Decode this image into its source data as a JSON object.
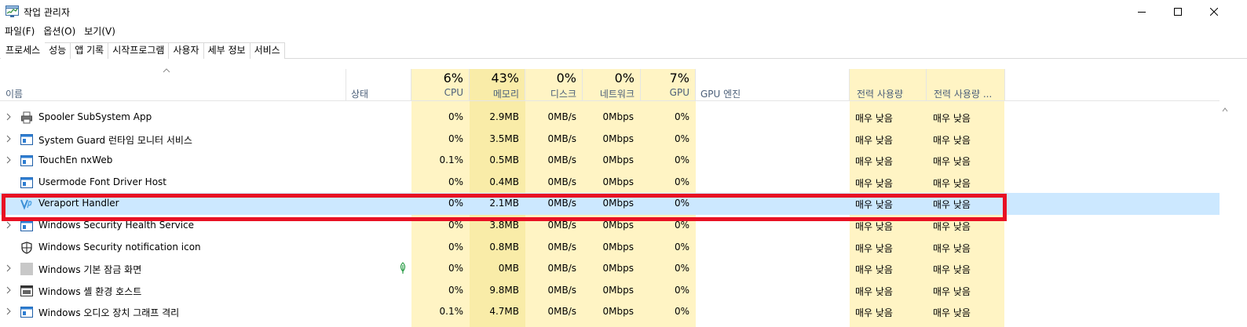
{
  "window": {
    "title": "작업 관리자"
  },
  "menu": [
    "파일(F)",
    "옵션(O)",
    "보기(V)"
  ],
  "tabs": [
    "프로세스",
    "성능",
    "앱 기록",
    "시작프로그램",
    "사용자",
    "세부 정보",
    "서비스"
  ],
  "active_tab": "프로세스",
  "columns": {
    "name": "이름",
    "status": "상태",
    "cpu": {
      "percent": "6%",
      "label": "CPU"
    },
    "memory": {
      "percent": "43%",
      "label": "메모리"
    },
    "disk": {
      "percent": "0%",
      "label": "디스크"
    },
    "network": {
      "percent": "0%",
      "label": "네트워크"
    },
    "gpu": {
      "percent": "7%",
      "label": "GPU"
    },
    "gpu_engine": "GPU 엔진",
    "power": "전력 사용량",
    "power_trend": "전력 사용량 ..."
  },
  "processes": [
    {
      "name": "Spooler SubSystem App",
      "icon": "printer-icon",
      "expandable": true,
      "cpu": "0%",
      "memory": "2.9MB",
      "disk": "0MB/s",
      "network": "0Mbps",
      "gpu": "0%",
      "power": "매우 낮음",
      "power_trend": "매우 낮음"
    },
    {
      "name": "System Guard 런타임 모니터 서비스",
      "icon": "window-app-icon",
      "expandable": true,
      "cpu": "0%",
      "memory": "3.5MB",
      "disk": "0MB/s",
      "network": "0Mbps",
      "gpu": "0%",
      "power": "매우 낮음",
      "power_trend": "매우 낮음"
    },
    {
      "name": "TouchEn nxWeb",
      "icon": "window-app-icon",
      "expandable": true,
      "cpu": "0.1%",
      "memory": "0.5MB",
      "disk": "0MB/s",
      "network": "0Mbps",
      "gpu": "0%",
      "power": "매우 낮음",
      "power_trend": "매우 낮음"
    },
    {
      "name": "Usermode Font Driver Host",
      "icon": "window-app-icon",
      "expandable": false,
      "cpu": "0%",
      "memory": "0.4MB",
      "disk": "0MB/s",
      "network": "0Mbps",
      "gpu": "0%",
      "power": "매우 낮음",
      "power_trend": "매우 낮음"
    },
    {
      "name": "Veraport Handler",
      "icon": "veraport-icon",
      "expandable": false,
      "selected": true,
      "cpu": "0%",
      "memory": "2.1MB",
      "disk": "0MB/s",
      "network": "0Mbps",
      "gpu": "0%",
      "power": "매우 낮음",
      "power_trend": "매우 낮음"
    },
    {
      "name": "Windows Security Health Service",
      "icon": "window-app-icon",
      "expandable": true,
      "cpu": "0%",
      "memory": "3.8MB",
      "disk": "0MB/s",
      "network": "0Mbps",
      "gpu": "0%",
      "power": "매우 낮음",
      "power_trend": "매우 낮음"
    },
    {
      "name": "Windows Security notification icon",
      "icon": "shield-icon",
      "expandable": false,
      "cpu": "0%",
      "memory": "0.8MB",
      "disk": "0MB/s",
      "network": "0Mbps",
      "gpu": "0%",
      "power": "매우 낮음",
      "power_trend": "매우 낮음"
    },
    {
      "name": "Windows 기본 잠금 화면",
      "icon": "gray-square-icon",
      "expandable": true,
      "eco": true,
      "cpu": "0%",
      "memory": "0MB",
      "disk": "0MB/s",
      "network": "0Mbps",
      "gpu": "0%",
      "power": "매우 낮음",
      "power_trend": "매우 낮음"
    },
    {
      "name": "Windows 셸 환경 호스트",
      "icon": "shell-host-icon",
      "expandable": true,
      "cpu": "0%",
      "memory": "9.8MB",
      "disk": "0MB/s",
      "network": "0Mbps",
      "gpu": "0%",
      "power": "매우 낮음",
      "power_trend": "매우 낮음"
    },
    {
      "name": "Windows 오디오 장치 그래프 격리",
      "icon": "window-app-icon",
      "expandable": true,
      "cpu": "0.1%",
      "memory": "4.7MB",
      "disk": "0MB/s",
      "network": "0Mbps",
      "gpu": "0%",
      "power": "매우 낮음",
      "power_trend": "매우 낮음"
    }
  ],
  "colors": {
    "heat_light": "#fff4c4",
    "heat_medium": "#f9eca8",
    "selected_row": "#cce8ff",
    "highlight_border": "#e81123",
    "header_label": "#4c607a"
  }
}
